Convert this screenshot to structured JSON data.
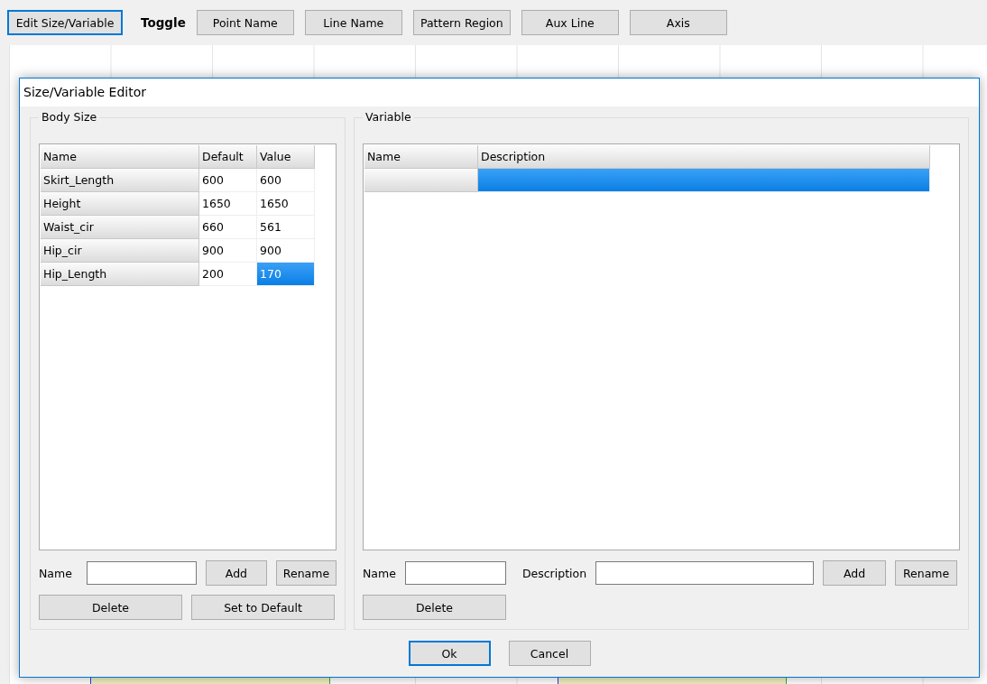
{
  "toolbar": {
    "edit_button": {
      "label": "Edit Size/Variable",
      "focused": true
    },
    "toggle_label": "Toggle",
    "toggle_buttons": [
      {
        "label": "Point Name"
      },
      {
        "label": "Line Name"
      },
      {
        "label": "Pattern Region"
      },
      {
        "label": "Aux Line"
      },
      {
        "label": "Axis"
      }
    ]
  },
  "dialog": {
    "title": "Size/Variable Editor",
    "body_size": {
      "title": "Body Size",
      "columns": [
        "Name",
        "Default",
        "Value"
      ],
      "rows": [
        {
          "name": "Skirt_Length",
          "default": "600",
          "value": "600",
          "selected": false
        },
        {
          "name": "Height",
          "default": "1650",
          "value": "1650",
          "selected": false
        },
        {
          "name": "Waist_cir",
          "default": "660",
          "value": "561",
          "selected": false
        },
        {
          "name": "Hip_cir",
          "default": "900",
          "value": "900",
          "selected": false
        },
        {
          "name": "Hip_Length",
          "default": "200",
          "value": "170",
          "selected": true
        }
      ],
      "name_label": "Name",
      "add_button": "Add",
      "rename_button": "Rename",
      "delete_button": "Delete",
      "default_button": "Set to Default"
    },
    "variable": {
      "title": "Variable",
      "columns": [
        "Name",
        "Description"
      ],
      "rows": [
        {
          "selected": true
        }
      ],
      "name_label": "Name",
      "description_label": "Description",
      "add_button": "Add",
      "rename_button": "Rename",
      "delete_button": "Delete"
    },
    "buttons": [
      {
        "label": "Ok",
        "focused": true
      },
      {
        "label": "Cancel",
        "focused": false
      }
    ]
  }
}
